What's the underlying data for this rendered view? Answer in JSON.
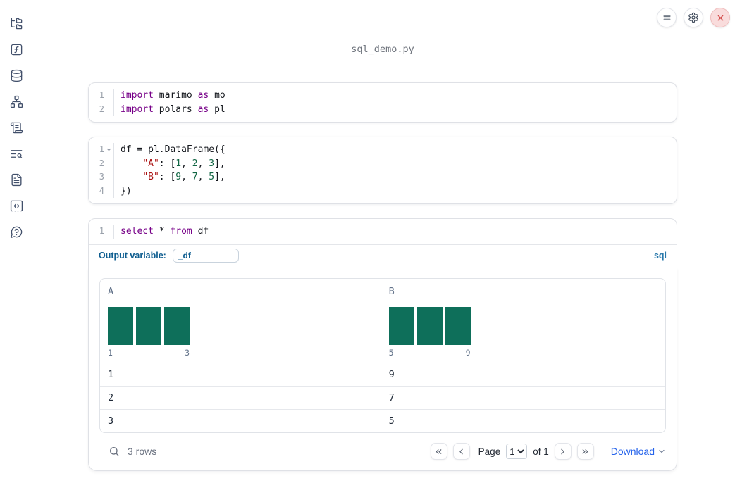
{
  "app": {
    "filename": "sql_demo.py"
  },
  "topbar": {
    "icons": [
      "hamburger-menu-icon",
      "gear-icon",
      "close-x-icon"
    ]
  },
  "sidebar": {
    "items": [
      {
        "name": "file-explorer",
        "icon": "folder-tree-icon"
      },
      {
        "name": "variables",
        "icon": "function-square-icon"
      },
      {
        "name": "data-sources",
        "icon": "database-icon"
      },
      {
        "name": "dependency-graph",
        "icon": "network-icon"
      },
      {
        "name": "outline",
        "icon": "scroll-text-icon"
      },
      {
        "name": "logs",
        "icon": "list-search-icon"
      },
      {
        "name": "documentation",
        "icon": "file-text-icon"
      },
      {
        "name": "snippets",
        "icon": "code-square-icon"
      },
      {
        "name": "help",
        "icon": "help-bubble-icon"
      }
    ]
  },
  "cells": [
    {
      "lines": [
        {
          "num": "1",
          "tokens": [
            [
              "kw",
              "import"
            ],
            [
              "pl",
              " marimo "
            ],
            [
              "kw",
              "as"
            ],
            [
              "pl",
              " mo"
            ]
          ]
        },
        {
          "num": "2",
          "tokens": [
            [
              "kw",
              "import"
            ],
            [
              "pl",
              " polars "
            ],
            [
              "kw",
              "as"
            ],
            [
              "pl",
              " pl"
            ]
          ]
        }
      ]
    },
    {
      "lines": [
        {
          "num": "1",
          "fold": true,
          "tokens": [
            [
              "pl",
              "df = pl.DataFrame({"
            ]
          ]
        },
        {
          "num": "2",
          "tokens": [
            [
              "pl",
              "    "
            ],
            [
              "str",
              "\"A\""
            ],
            [
              "pl",
              ": ["
            ],
            [
              "num",
              "1"
            ],
            [
              "pl",
              ", "
            ],
            [
              "num",
              "2"
            ],
            [
              "pl",
              ", "
            ],
            [
              "num",
              "3"
            ],
            [
              "pl",
              "],"
            ]
          ]
        },
        {
          "num": "3",
          "tokens": [
            [
              "pl",
              "    "
            ],
            [
              "str",
              "\"B\""
            ],
            [
              "pl",
              ": ["
            ],
            [
              "num",
              "9"
            ],
            [
              "pl",
              ", "
            ],
            [
              "num",
              "7"
            ],
            [
              "pl",
              ", "
            ],
            [
              "num",
              "5"
            ],
            [
              "pl",
              "],"
            ]
          ]
        },
        {
          "num": "4",
          "tokens": [
            [
              "pl",
              "})"
            ]
          ]
        }
      ]
    },
    {
      "lines": [
        {
          "num": "1",
          "tokens": [
            [
              "kw",
              "select"
            ],
            [
              "pl",
              " * "
            ],
            [
              "kw",
              "from"
            ],
            [
              "pl",
              " df"
            ]
          ]
        }
      ]
    }
  ],
  "sql_cell": {
    "output_variable_label": "Output variable:",
    "output_variable_value": "_df",
    "language_label": "sql"
  },
  "table": {
    "hist_color": "#0e6f5a",
    "columns": [
      {
        "name": "A",
        "hist_bars": [
          1,
          1,
          1
        ],
        "hist_min": "1",
        "hist_max": "3"
      },
      {
        "name": "B",
        "hist_bars": [
          1,
          1,
          1
        ],
        "hist_min": "5",
        "hist_max": "9"
      }
    ],
    "rows": [
      [
        "1",
        "9"
      ],
      [
        "2",
        "7"
      ],
      [
        "3",
        "5"
      ]
    ],
    "footer": {
      "row_count": "3 rows",
      "page_label": "Page",
      "page_value": "1",
      "of_label": "of 1",
      "download_label": "Download"
    }
  }
}
